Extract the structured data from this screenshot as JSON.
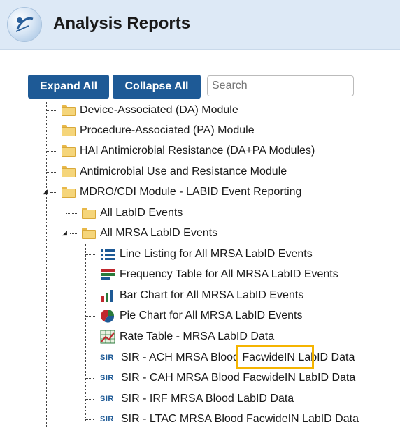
{
  "header": {
    "title": "Analysis Reports",
    "logo_icon": "nhsn-logo-icon"
  },
  "toolbar": {
    "expand_label": "Expand All",
    "collapse_label": "Collapse All",
    "search_placeholder": "Search",
    "accent": "#1e5a96"
  },
  "tree": {
    "modules": [
      {
        "label": "Device-Associated (DA) Module"
      },
      {
        "label": "Procedure-Associated (PA) Module"
      },
      {
        "label": "HAI Antimicrobial Resistance (DA+PA Modules)"
      },
      {
        "label": "Antimicrobial Use and Resistance Module"
      },
      {
        "label": "MDRO/CDI Module - LABID Event Reporting"
      }
    ],
    "subfolders": [
      {
        "label": "All LabID Events"
      },
      {
        "label": "All MRSA LabID Events"
      }
    ],
    "reports": [
      {
        "label": "Line Listing for All MRSA LabID Events",
        "icon": "line-listing-icon"
      },
      {
        "label": "Frequency Table for All MRSA LabID Events",
        "icon": "frequency-table-icon"
      },
      {
        "label": "Bar Chart for All MRSA LabID Events",
        "icon": "bar-chart-icon"
      },
      {
        "label": "Pie Chart for All MRSA LabID Events",
        "icon": "pie-chart-icon"
      },
      {
        "label": "Rate Table - MRSA LabID Data",
        "icon": "rate-table-icon"
      },
      {
        "label": "SIR - ACH MRSA Blood FacwideIN LabID Data",
        "icon": "SIR"
      },
      {
        "label": "SIR - CAH MRSA Blood FacwideIN LabID Data",
        "icon": "SIR"
      },
      {
        "label": "SIR - IRF MRSA Blood LabID Data",
        "icon": "SIR"
      },
      {
        "label": "SIR - LTAC MRSA Blood FacwideIN LabID Data",
        "icon": "SIR"
      }
    ]
  },
  "highlight_color": "#f5b400"
}
